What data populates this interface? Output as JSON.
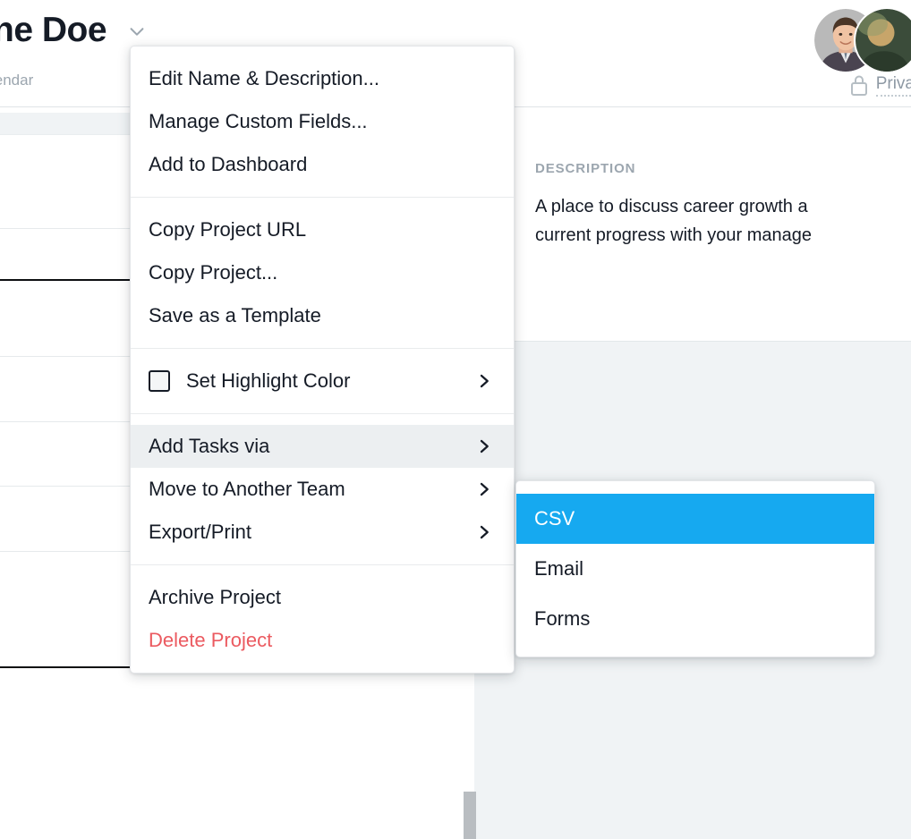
{
  "header": {
    "project_title": "ne Doe",
    "title_chevron_icon": "chevron-down-icon",
    "tabs": [
      {
        "label": "lendar"
      },
      {
        "label": ""
      }
    ],
    "privacy": {
      "icon": "lock-icon",
      "label": "Priva"
    }
  },
  "detail_panel": {
    "description_label": "DESCRIPTION",
    "description_line_1": "A place to discuss career growth a",
    "description_line_2": "current progress with your manage"
  },
  "context_menu": {
    "groups": [
      {
        "items": [
          {
            "label": "Edit Name & Description...",
            "type": "plain"
          },
          {
            "label": "Manage Custom Fields...",
            "type": "plain"
          },
          {
            "label": "Add to Dashboard",
            "type": "plain"
          }
        ]
      },
      {
        "items": [
          {
            "label": "Copy Project URL",
            "type": "plain"
          },
          {
            "label": "Copy Project...",
            "type": "plain"
          },
          {
            "label": "Save as a Template",
            "type": "plain"
          }
        ]
      },
      {
        "items": [
          {
            "label": "Set Highlight Color",
            "type": "swatch-submenu"
          }
        ]
      },
      {
        "items": [
          {
            "label": "Add Tasks via",
            "type": "submenu",
            "hovered": true
          },
          {
            "label": "Move to Another Team",
            "type": "submenu"
          },
          {
            "label": "Export/Print",
            "type": "submenu"
          }
        ]
      },
      {
        "items": [
          {
            "label": "Archive Project",
            "type": "plain"
          },
          {
            "label": "Delete Project",
            "type": "danger"
          }
        ]
      }
    ]
  },
  "submenu": {
    "parent": "Add Tasks via",
    "items": [
      {
        "label": "CSV",
        "selected": true
      },
      {
        "label": "Email",
        "selected": false
      },
      {
        "label": "Forms",
        "selected": false
      }
    ]
  },
  "colors": {
    "accent_blue": "#16a9f0",
    "danger_red": "#eb5a60",
    "text_primary": "#151b26",
    "text_muted": "#9ca6af",
    "panel_bg": "#f0f3f5",
    "hover_bg": "#eceff1"
  }
}
